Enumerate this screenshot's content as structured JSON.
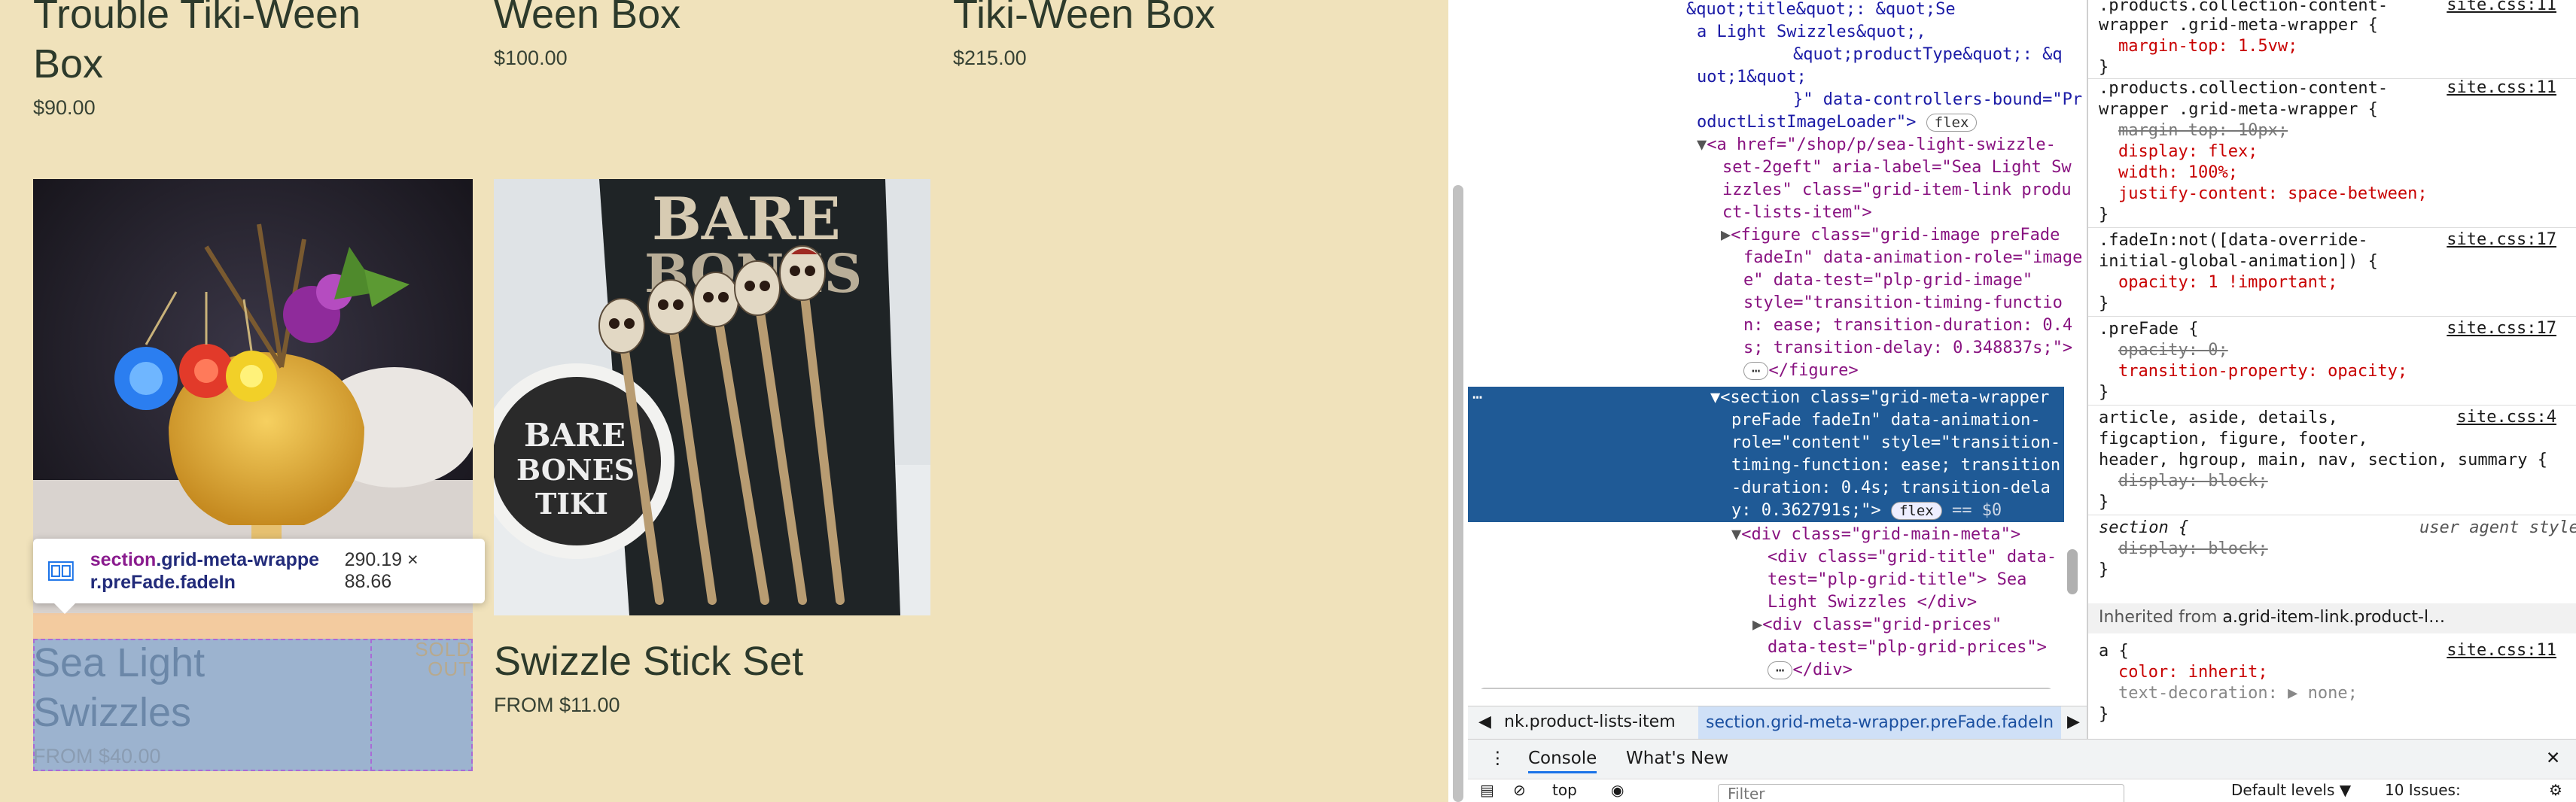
{
  "products": {
    "top": [
      {
        "title": "Trouble Tiki-Ween\nBox",
        "price": "$90.00"
      },
      {
        "title": "Ween Box",
        "price": "$100.00"
      },
      {
        "title": "Tiki-Ween Box",
        "price": "$215.00"
      }
    ],
    "bottom": [
      {
        "title": "Sea Light\nSwizzles",
        "price": "FROM $40.00",
        "badge": "SOLD\nOUT"
      },
      {
        "title": "Swizzle Stick Set",
        "price": "FROM $11.00"
      }
    ]
  },
  "tooltip": {
    "tag": "section",
    "cls1": ".grid-meta-wrappe",
    "cls2": "r.preFade.fadeIn",
    "size": "290.19 × 88.66"
  },
  "elements": {
    "l1": "&quot;title&quot;: &quot;Se",
    "l2": "a Light Swizzles&quot;,",
    "l3": "&quot;productType&quot;: &q",
    "l4": "uot;1&quot;",
    "l5": "}\" data-controllers-bound=\"Pr",
    "l6": "oductListImageLoader\">",
    "flex": "flex",
    "a1": "<a href=\"/shop/p/sea-light-swizzle-",
    "a2": "set-2geft\" aria-label=\"Sea Light Sw",
    "a3": "izzles\" class=\"grid-item-link produ",
    "a4": "ct-lists-item\">",
    "f1": "<figure class=\"grid-image preFade",
    "f2": "fadeIn\" data-animation-role=\"image",
    "f3": "e\" data-test=\"plp-grid-image\"",
    "f4": "style=\"transition-timing-functio",
    "f5": "n: ease; transition-duration: 0.4",
    "f6": "s; transition-delay: 0.348837s;\">",
    "f7": "</figure>",
    "s1": "<section class=\"grid-meta-wrapper",
    "s2": "preFade fadeIn\" data-animation-",
    "s3": "role=\"content\" style=\"transition-",
    "s4": "timing-function: ease; transition",
    "s5": "-duration: 0.4s; transition-dela",
    "s6": "y: 0.362791s;\">",
    "s6b": "== $0",
    "d1": "<div class=\"grid-main-meta\">",
    "d2": "<div class=\"grid-title\" data-",
    "d3": "test=\"plp-grid-title\"> Sea",
    "d4": "Light Swizzles </div>",
    "d5": "<div class=\"grid-prices\"",
    "d6": "data-test=\"plp-grid-prices\">",
    "d7": "</div>"
  },
  "styles": {
    "r1a": ".products.collection-content-",
    "r1b": "wrapper .grid-meta-wrapper {",
    "r1p": "margin-top: 1.5vw;",
    "r2a": ".products.collection-content-",
    "r2b": "wrapper .grid-meta-wrapper {",
    "r2p1": "margin-top: 10px;",
    "r2p2": "display: flex;",
    "r2p3": "width: 100%;",
    "r2p4": "justify-content: space-between;",
    "r3a": ".fadeIn:not([data-override-",
    "r3b": "initial-global-animation]) {",
    "r3p": "opacity: 1 !important;",
    "r4a": ".preFade {",
    "r4p1": "opacity: 0;",
    "r4p2": "transition-property: opacity;",
    "r5a": "article, aside, details,",
    "r5b": "figcaption, figure, footer,",
    "r5c": "header, hgroup, main, nav, section, summary {",
    "r5p": "display: block;",
    "r6a": "section {",
    "r6ua": "user agent stylesheet",
    "r6p": "display: block;",
    "close": "}",
    "src11": "site.css:11",
    "src17": "site.css:17",
    "src4": "site.css:4",
    "inherit_label": "Inherited from",
    "inherit_link": "a.grid-item-link.product-l…",
    "r7a": "a {",
    "r7p1": "color: inherit;",
    "r7p2": "text-decoration: ▶ none;"
  },
  "breadcrumbs": {
    "item1": "nk.product-lists-item",
    "item2": "section.grid-meta-wrapper.preFade.fadeIn"
  },
  "drawer": {
    "console": "Console",
    "whats_new": "What's New",
    "filter": "Filter",
    "levels": "Default levels ▼",
    "issues": "10 Issues:",
    "top": "top"
  }
}
